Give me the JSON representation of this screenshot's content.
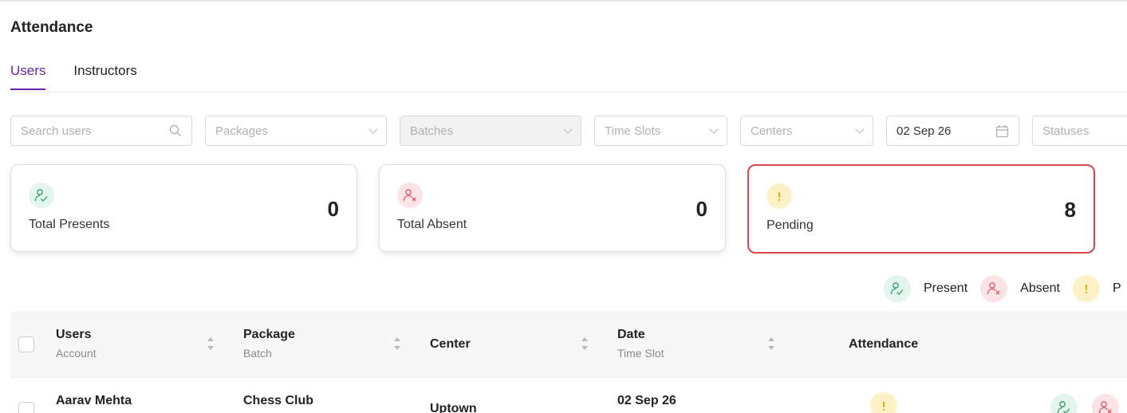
{
  "page": {
    "title": "Attendance"
  },
  "tabs": [
    {
      "label": "Users",
      "active": true
    },
    {
      "label": "Instructors",
      "active": false
    }
  ],
  "filters": {
    "search": {
      "placeholder": "Search users"
    },
    "packages": {
      "placeholder": "Packages"
    },
    "batches": {
      "placeholder": "Batches",
      "disabled": true
    },
    "time_slots": {
      "placeholder": "Time Slots"
    },
    "centers": {
      "placeholder": "Centers"
    },
    "date": {
      "value": "02 Sep 26"
    },
    "statuses": {
      "placeholder": "Statuses"
    }
  },
  "stats": [
    {
      "label": "Total Presents",
      "value": "0",
      "icon": "user-check-icon",
      "color": "#2e9e6b"
    },
    {
      "label": "Total Absent",
      "value": "0",
      "icon": "user-x-icon",
      "color": "#e2586a"
    },
    {
      "label": "Pending",
      "value": "8",
      "icon": "exclamation-icon",
      "color": "#e0a800",
      "highlighted": true
    }
  ],
  "legend": {
    "present": "Present",
    "absent": "Absent",
    "pending_partial": "P"
  },
  "table": {
    "columns": [
      {
        "title": "Users",
        "subtitle": "Account"
      },
      {
        "title": "Package",
        "subtitle": "Batch"
      },
      {
        "title": "Center",
        "subtitle": ""
      },
      {
        "title": "Date",
        "subtitle": "Time Slot"
      },
      {
        "title": "Attendance",
        "subtitle": ""
      }
    ],
    "rows": [
      {
        "user": "Aarav Mehta",
        "package": "Chess Club",
        "center": "Uptown",
        "date": "02 Sep 26"
      }
    ]
  },
  "colors": {
    "accent": "#6b21a8",
    "highlight_border": "#d9454e"
  }
}
